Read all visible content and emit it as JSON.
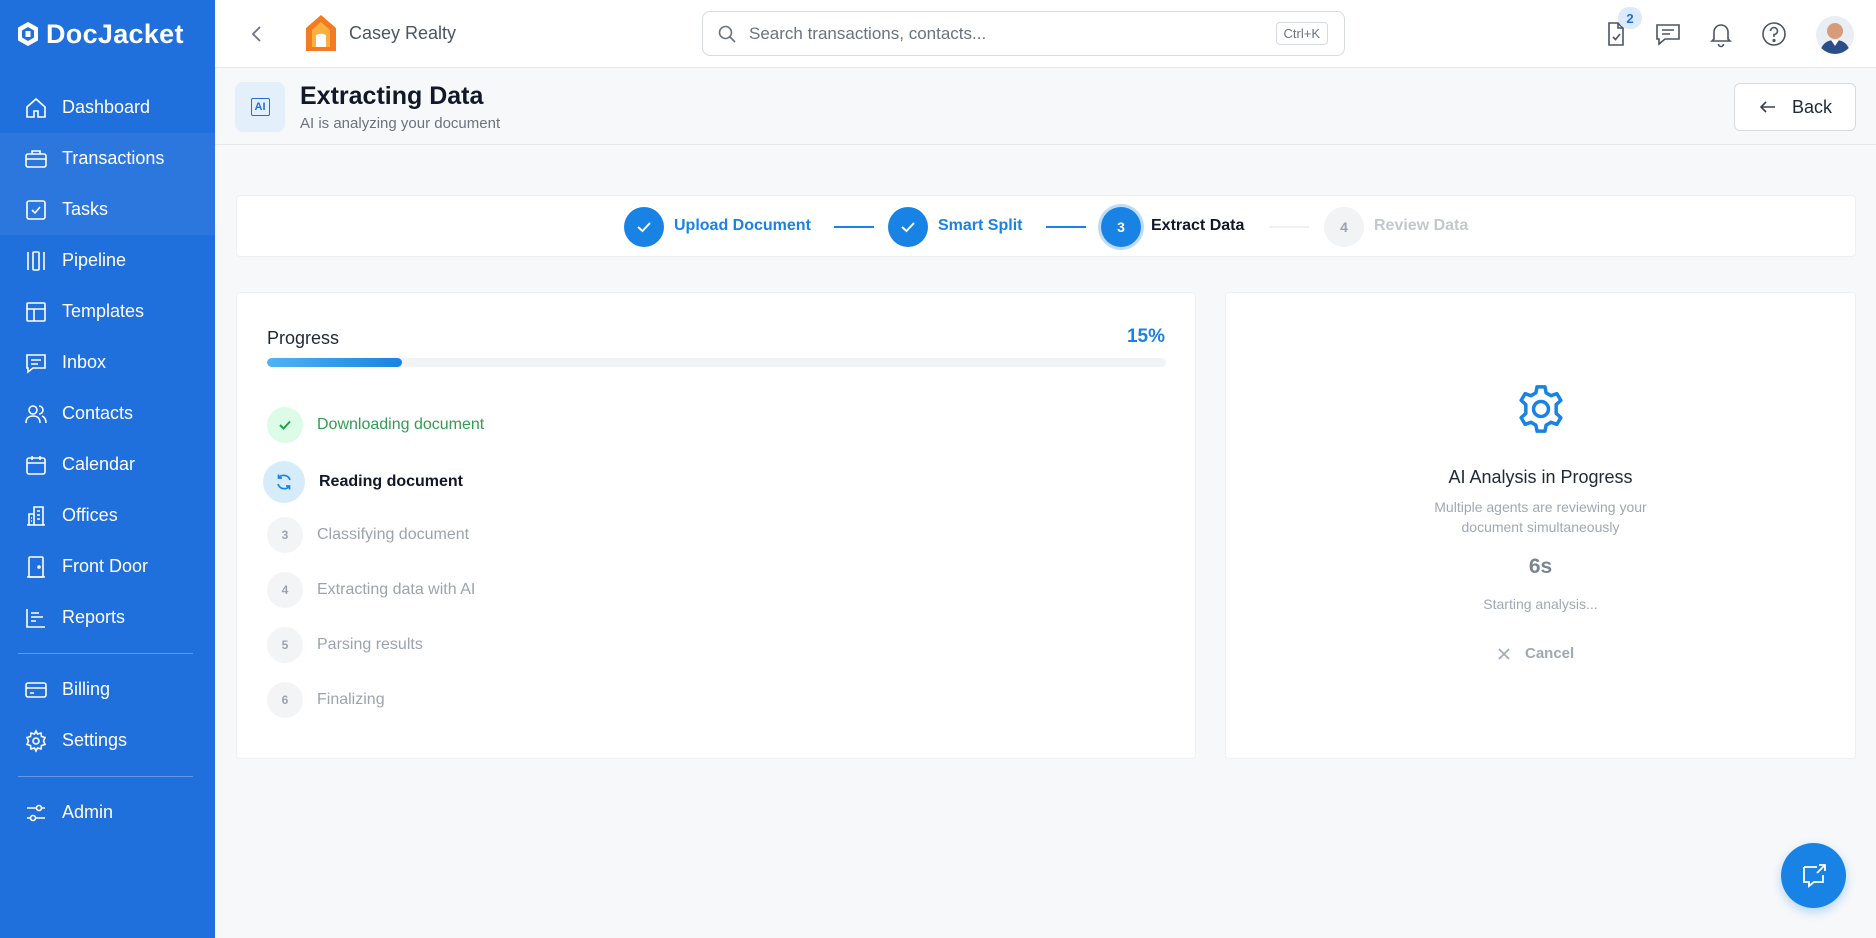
{
  "brand": {
    "name": "DocJacket",
    "color": "#1f6fdc",
    "accent": "#1883e4"
  },
  "sidebar": {
    "items": [
      {
        "label": "Dashboard",
        "icon": "home-icon"
      },
      {
        "label": "Transactions",
        "icon": "briefcase-icon"
      },
      {
        "label": "Tasks",
        "icon": "checkbox-icon"
      },
      {
        "label": "Pipeline",
        "icon": "pipeline-icon"
      },
      {
        "label": "Templates",
        "icon": "template-icon"
      },
      {
        "label": "Inbox",
        "icon": "inbox-icon"
      },
      {
        "label": "Contacts",
        "icon": "users-icon"
      },
      {
        "label": "Calendar",
        "icon": "calendar-icon"
      },
      {
        "label": "Offices",
        "icon": "building-icon"
      },
      {
        "label": "Front Door",
        "icon": "door-icon"
      },
      {
        "label": "Reports",
        "icon": "reports-icon"
      },
      {
        "label": "Billing",
        "icon": "credit-card-icon"
      },
      {
        "label": "Settings",
        "icon": "gear-icon"
      },
      {
        "label": "Admin",
        "icon": "sliders-icon"
      }
    ]
  },
  "topbar": {
    "org_name": "Casey Realty",
    "search_placeholder": "Search transactions, contacts...",
    "search_shortcut": "Ctrl+K",
    "tasks_badge": "2"
  },
  "header": {
    "icon_text": "AI",
    "title": "Extracting Data",
    "subtitle": "AI is analyzing your document",
    "back_label": "Back"
  },
  "stepper": {
    "steps": [
      {
        "number": "1",
        "label": "Upload Document",
        "state": "done"
      },
      {
        "number": "2",
        "label": "Smart Split",
        "state": "done"
      },
      {
        "number": "3",
        "label": "Extract Data",
        "state": "current"
      },
      {
        "number": "4",
        "label": "Review Data",
        "state": "pending"
      }
    ]
  },
  "progress": {
    "label": "Progress",
    "percent_label": "15%",
    "percent": 15,
    "tasks": [
      {
        "number": "1",
        "label": "Downloading document",
        "state": "done"
      },
      {
        "number": "2",
        "label": "Reading document",
        "state": "active"
      },
      {
        "number": "3",
        "label": "Classifying document",
        "state": "pending"
      },
      {
        "number": "4",
        "label": "Extracting data with AI",
        "state": "pending"
      },
      {
        "number": "5",
        "label": "Parsing results",
        "state": "pending"
      },
      {
        "number": "6",
        "label": "Finalizing",
        "state": "pending"
      }
    ]
  },
  "analysis": {
    "title": "AI Analysis in Progress",
    "description": "Multiple agents are reviewing your document simultaneously",
    "timer": "6s",
    "status": "Starting analysis...",
    "cancel_label": "Cancel"
  }
}
